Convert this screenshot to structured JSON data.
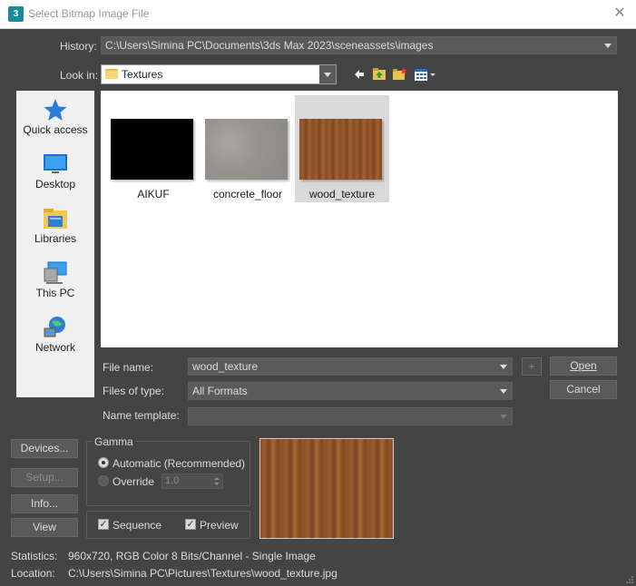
{
  "window": {
    "title": "Select Bitmap Image File",
    "app_icon_text": "3"
  },
  "history": {
    "label": "History:",
    "value": "C:\\Users\\Simina PC\\Documents\\3ds Max 2023\\sceneassets\\images"
  },
  "lookin": {
    "label": "Look in:",
    "value": "Textures"
  },
  "places": [
    {
      "label": "Quick access",
      "icon": "quick-access-star-icon"
    },
    {
      "label": "Desktop",
      "icon": "desktop-icon"
    },
    {
      "label": "Libraries",
      "icon": "libraries-icon"
    },
    {
      "label": "This PC",
      "icon": "this-pc-icon"
    },
    {
      "label": "Network",
      "icon": "network-icon"
    }
  ],
  "files": [
    {
      "name": "AIKUF",
      "color": "#000000",
      "selected": false
    },
    {
      "name": "concrete_floor",
      "color": "#9c9a93",
      "selected": false
    },
    {
      "name": "wood_texture",
      "color": "#8a4f27",
      "selected": true
    }
  ],
  "filename": {
    "label": "File name:",
    "value": "wood_texture"
  },
  "filetype": {
    "label": "Files of type:",
    "value": "All Formats"
  },
  "nametemplate": {
    "label": "Name template:",
    "value": ""
  },
  "buttons": {
    "plus": "+",
    "open": "Open",
    "cancel": "Cancel",
    "devices": "Devices...",
    "setup": "Setup...",
    "info": "Info...",
    "view": "View"
  },
  "gamma": {
    "title": "Gamma",
    "automatic": "Automatic (Recommended)",
    "override": "Override",
    "override_value": "1.0",
    "selected": "automatic"
  },
  "options": {
    "sequence": "Sequence",
    "sequence_checked": true,
    "preview": "Preview",
    "preview_checked": true
  },
  "statistics": {
    "label": "Statistics:",
    "value": "960x720, RGB Color 8 Bits/Channel - Single Image"
  },
  "location": {
    "label": "Location:",
    "value": "C:\\Users\\Simina PC\\Pictures\\Textures\\wood_texture.jpg"
  },
  "colors": {
    "background": "#444444",
    "accent": "#0078d7",
    "wood": "#8a4f27"
  }
}
